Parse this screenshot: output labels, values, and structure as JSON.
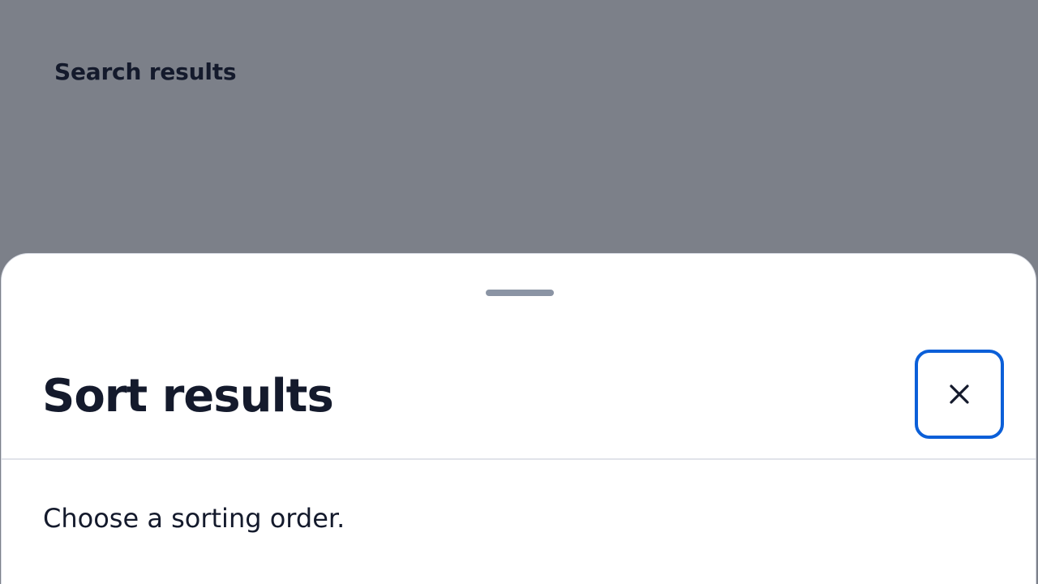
{
  "background_page": {
    "title": "Search results"
  },
  "sort_sheet": {
    "title": "Sort results",
    "description": "Choose a sorting order.",
    "close_icon": "close-icon",
    "close_label": "Close"
  },
  "colors": {
    "overlay": "#7c8089",
    "text": "#141a2c",
    "focus_ring": "#0b5fd8",
    "divider": "#e1e3ea",
    "drag_handle": "#8b94a4"
  }
}
